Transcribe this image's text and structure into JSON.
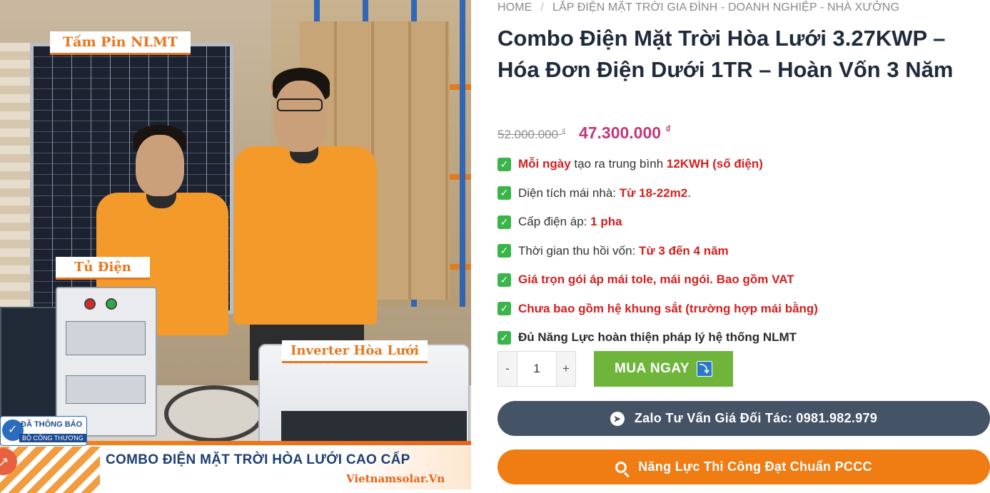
{
  "image": {
    "labels": {
      "panel": "Tấm Pin NLMT",
      "cabinet": "Tủ Điện",
      "inverter": "Inverter Hòa Lưới"
    },
    "badge": {
      "line1": "ĐÃ THÔNG BÁO",
      "line2": "BỘ CÔNG THƯƠNG"
    },
    "banner_title": "COMBO ĐIỆN MẶT TRỜI HÒA LƯỚI CAO CẤP",
    "banner_site": "Vietnamsolar.Vn"
  },
  "breadcrumb": {
    "home": "HOME",
    "separator": "/",
    "category": "LẮP ĐIỆN MẶT TRỜI GIA ĐÌNH - DOANH NGHIỆP - NHÀ XƯỞNG"
  },
  "product": {
    "title": "Combo Điện Mặt Trời Hòa Lưới 3.27KWP – Hóa Đơn Điện Dưới 1TR – Hoàn Vốn 3 Năm",
    "old_price": "52.000.000",
    "new_price": "47.300.000",
    "currency": "₫"
  },
  "features": {
    "f1": {
      "a": "Mỗi ngày",
      "b": " tạo ra trung bình ",
      "c": "12KWH (số điện)"
    },
    "f2": {
      "a": "Diện tích mái nhà: ",
      "b": "Từ 18-22m2",
      "c": "."
    },
    "f3": {
      "a": "Cấp điện áp: ",
      "b": "1 pha"
    },
    "f4": {
      "a": "Thời gian thu hồi vốn: ",
      "b": "Từ 3 đến 4 năm"
    },
    "f5": {
      "a": "Giá trọn gói áp mái tole, mái ngói. Bao gồm VAT"
    },
    "f6": {
      "a": "Chưa bao gồm hệ khung sắt (trường hợp mái bằng)"
    },
    "f7": {
      "a": "Đủ Năng Lực hoàn thiện pháp lý hệ thống NLMT"
    }
  },
  "cart": {
    "minus": "-",
    "plus": "+",
    "quantity": "1",
    "buy_label": "MUA NGAY"
  },
  "cta": {
    "zalo": "Zalo Tư Vấn Giá Đối Tác: 0981.982.979",
    "pccc": "Năng Lực Thi Công Đạt Chuẩn PCCC"
  },
  "colors": {
    "price_accent": "#c0397b",
    "highlight_red": "#d42020",
    "buy_green": "#6fb53c",
    "zalo_button": "#455367",
    "pccc_button": "#f07c14"
  },
  "icons": {
    "check": "✓",
    "arrow_down": "⤵",
    "send": "➤"
  }
}
